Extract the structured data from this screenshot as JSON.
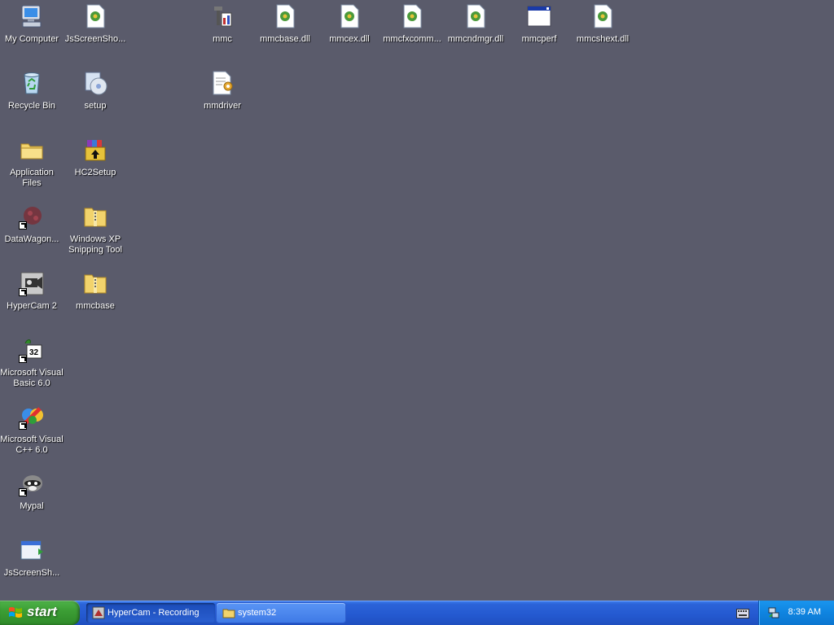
{
  "desktop": {
    "background_color": "#5a5b6b",
    "icons": {
      "my_computer": "My Computer",
      "jsscreenshot_top": "JsScreenSho...",
      "mmc": "mmc",
      "mmcbase_dll": "mmcbase.dll",
      "mmcex_dll": "mmcex.dll",
      "mmcfxcomm": "mmcfxcomm...",
      "mmcndmgr_dll": "mmcndmgr.dll",
      "mmcperf": "mmcperf",
      "mmcshext_dll": "mmcshext.dll",
      "recycle_bin": "Recycle Bin",
      "setup": "setup",
      "mmdriver": "mmdriver",
      "application_files": "Application\nFiles",
      "hc2setup": "HC2Setup",
      "datawagon": "DataWagon...",
      "snipping_tool": "Windows XP\nSnipping Tool",
      "hypercam2": "HyperCam 2",
      "mmcbase_zip": "mmcbase",
      "vb6": "Microsoft Visual\nBasic 6.0",
      "vc6": "Microsoft Visual\nC++ 6.0",
      "mypal": "Mypal",
      "jsscreenshot_bottom": "JsScreenSh..."
    }
  },
  "taskbar": {
    "start_label": "start",
    "tasks": [
      {
        "label": "HyperCam - Recording",
        "state": "active"
      },
      {
        "label": "system32",
        "state": "inactive"
      }
    ],
    "clock": "8:39 AM"
  }
}
